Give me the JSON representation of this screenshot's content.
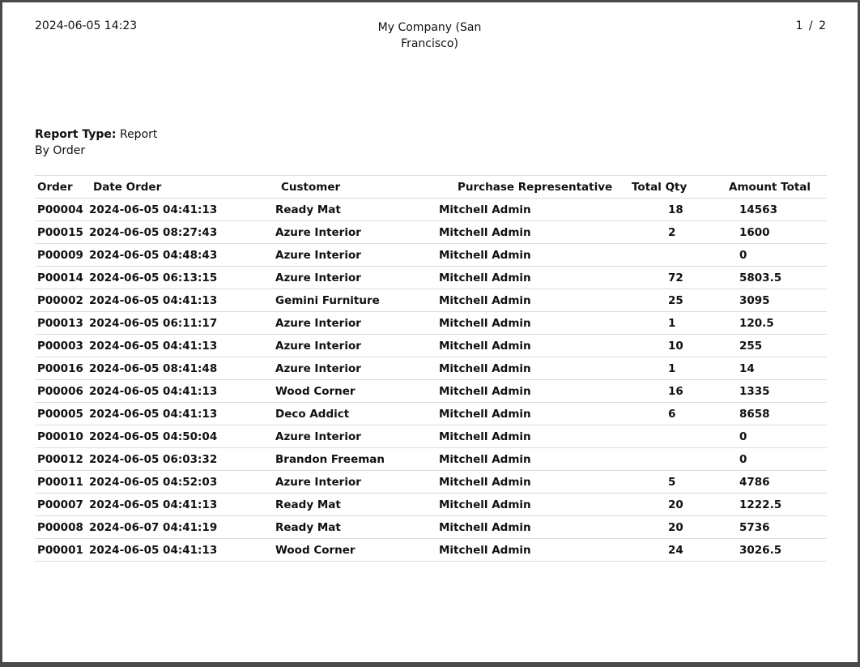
{
  "header": {
    "datetime": "2024-06-05 14:23",
    "company_line1": "My Company (San",
    "company_line2": "Francisco)",
    "pager": "1 / 2"
  },
  "report": {
    "type_label": "Report Type:",
    "type_value": "Report",
    "type_value2": "By Order"
  },
  "table": {
    "columns": [
      "Order",
      "Date Order",
      "Customer",
      "Purchase Representative",
      "Total Qty",
      "Amount Total"
    ],
    "rows": [
      [
        "P00004",
        "2024-06-05 04:41:13",
        "Ready Mat",
        "Mitchell Admin",
        "18",
        "14563"
      ],
      [
        "P00015",
        "2024-06-05 08:27:43",
        "Azure Interior",
        "Mitchell Admin",
        "2",
        "1600"
      ],
      [
        "P00009",
        "2024-06-05 04:48:43",
        "Azure Interior",
        "Mitchell Admin",
        "",
        "0"
      ],
      [
        "P00014",
        "2024-06-05 06:13:15",
        "Azure Interior",
        "Mitchell Admin",
        "72",
        "5803.5"
      ],
      [
        "P00002",
        "2024-06-05 04:41:13",
        "Gemini Furniture",
        "Mitchell Admin",
        "25",
        "3095"
      ],
      [
        "P00013",
        "2024-06-05 06:11:17",
        "Azure Interior",
        "Mitchell Admin",
        "1",
        "120.5"
      ],
      [
        "P00003",
        "2024-06-05 04:41:13",
        "Azure Interior",
        "Mitchell Admin",
        "10",
        "255"
      ],
      [
        "P00016",
        "2024-06-05 08:41:48",
        "Azure Interior",
        "Mitchell Admin",
        "1",
        "14"
      ],
      [
        "P00006",
        "2024-06-05 04:41:13",
        "Wood Corner",
        "Mitchell Admin",
        "16",
        "1335"
      ],
      [
        "P00005",
        "2024-06-05 04:41:13",
        "Deco Addict",
        "Mitchell Admin",
        "6",
        "8658"
      ],
      [
        "P00010",
        "2024-06-05 04:50:04",
        "Azure Interior",
        "Mitchell Admin",
        "",
        "0"
      ],
      [
        "P00012",
        "2024-06-05 06:03:32",
        "Brandon Freeman",
        "Mitchell Admin",
        "",
        "0"
      ],
      [
        "P00011",
        "2024-06-05 04:52:03",
        "Azure Interior",
        "Mitchell Admin",
        "5",
        "4786"
      ],
      [
        "P00007",
        "2024-06-05 04:41:13",
        "Ready Mat",
        "Mitchell Admin",
        "20",
        "1222.5"
      ],
      [
        "P00008",
        "2024-06-07 04:41:19",
        "Ready Mat",
        "Mitchell Admin",
        "20",
        "5736"
      ],
      [
        "P00001",
        "2024-06-05 04:41:13",
        "Wood Corner",
        "Mitchell Admin",
        "24",
        "3026.5"
      ]
    ]
  }
}
